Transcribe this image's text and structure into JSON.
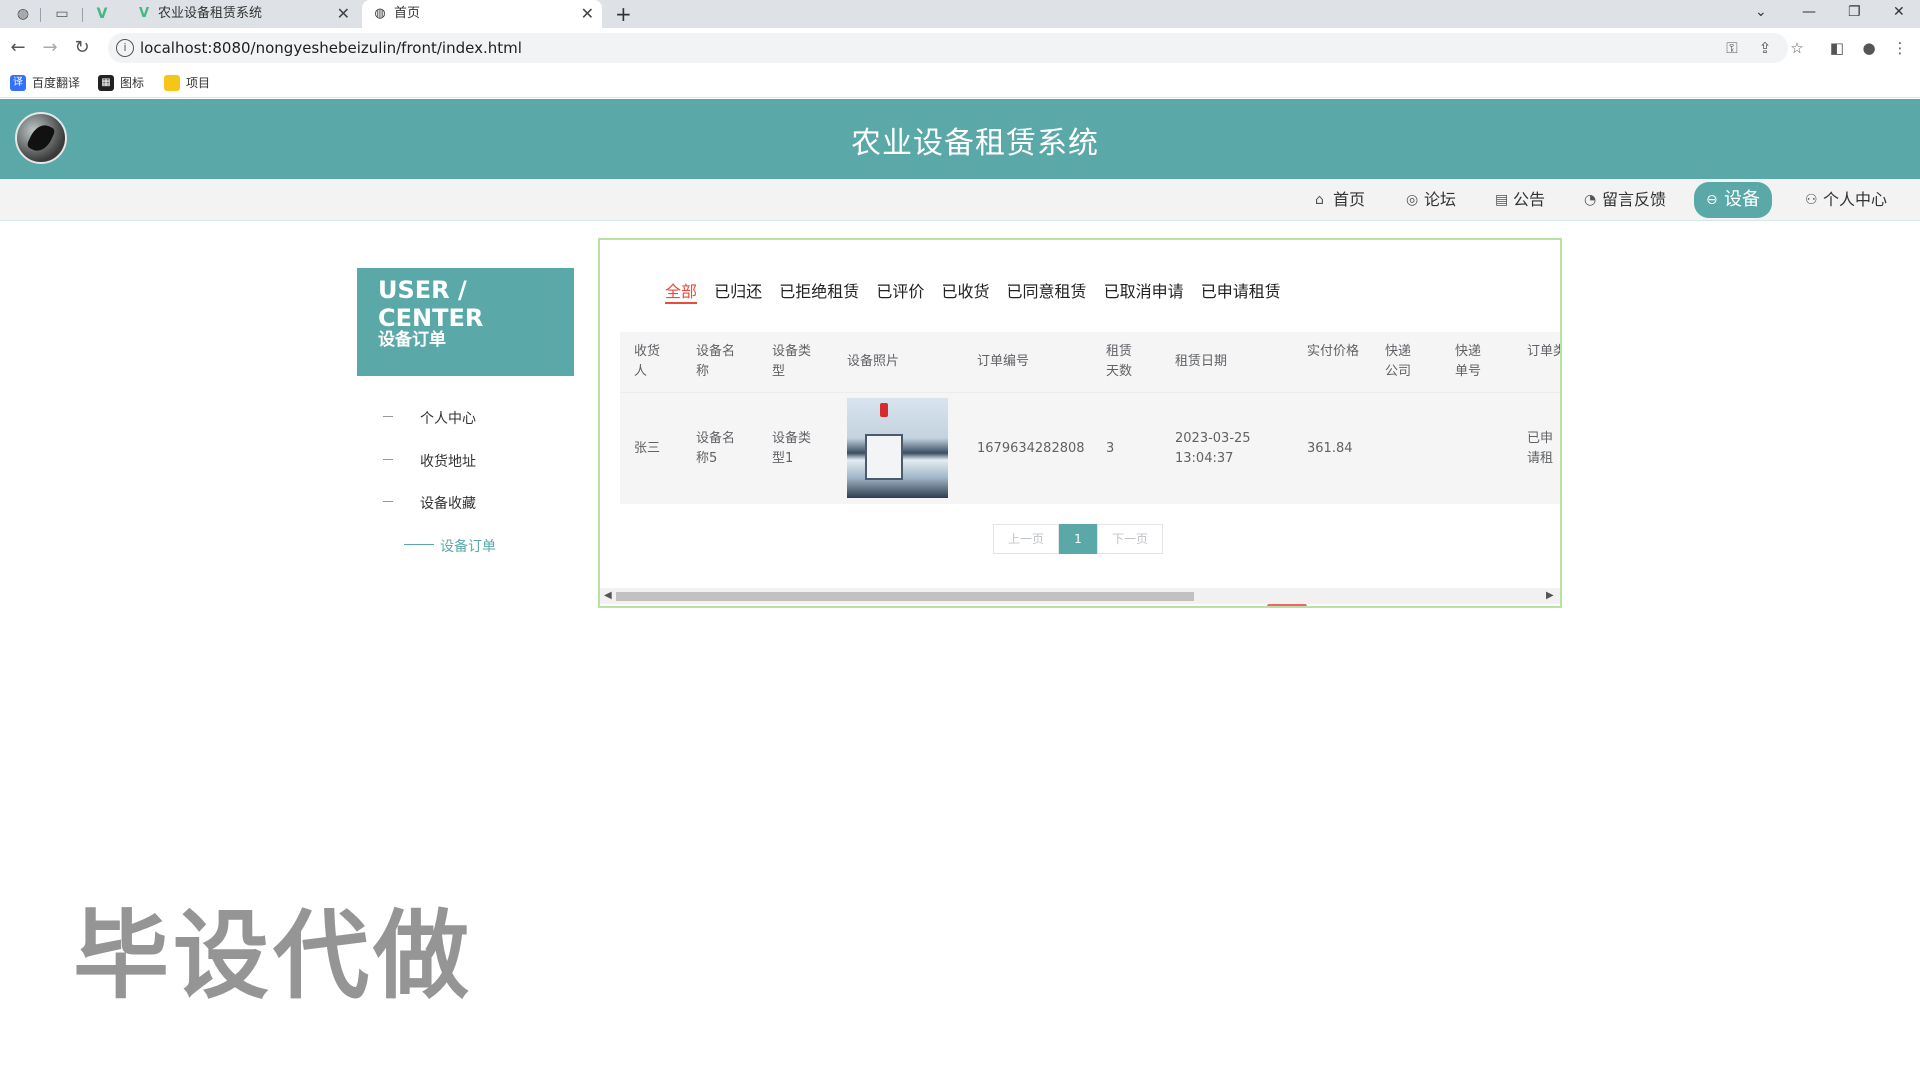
{
  "browser": {
    "tabs": [
      {
        "label": "农业设备租赁系统"
      },
      {
        "label": "首页"
      }
    ],
    "new_tab": "+",
    "url": "localhost:8080/nongyeshebeizulin/front/index.html",
    "bookmarks": [
      {
        "label": "百度翻译"
      },
      {
        "label": "图标"
      },
      {
        "label": "项目"
      }
    ]
  },
  "site": {
    "title": "农业设备租赁系统"
  },
  "nav": {
    "items": [
      {
        "label": "首页",
        "icon": "home-icon"
      },
      {
        "label": "论坛",
        "icon": "globe-icon"
      },
      {
        "label": "公告",
        "icon": "calendar-icon"
      },
      {
        "label": "留言反馈",
        "icon": "feedback-icon"
      },
      {
        "label": "设备",
        "icon": "equipment-icon",
        "active": true
      },
      {
        "label": "个人中心",
        "icon": "user-icon"
      }
    ]
  },
  "sidebar": {
    "heading_en": "USER / CENTER",
    "heading_cn": "设备订单",
    "items": [
      {
        "label": "个人中心"
      },
      {
        "label": "收货地址"
      },
      {
        "label": "设备收藏"
      },
      {
        "label": "设备订单",
        "active": true
      }
    ]
  },
  "filters": {
    "tabs": [
      "全部",
      "已归还",
      "已拒绝租赁",
      "已评价",
      "已收货",
      "已同意租赁",
      "已取消申请",
      "已申请租赁"
    ],
    "active_index": 0
  },
  "table": {
    "headers": [
      "收货人",
      "设备名称",
      "设备类型",
      "设备照片",
      "订单编号",
      "租赁天数",
      "租赁日期",
      "实付价格",
      "快递公司",
      "快递单号",
      "订单类型"
    ],
    "rows": [
      {
        "receiver": "张三",
        "device_name": "设备名称5",
        "device_type": "设备类型1",
        "order_no": "1679634282808",
        "days": "3",
        "date": "2023-03-25 13:04:37",
        "price": "361.84",
        "courier": "",
        "tracking": "",
        "order_type": "已申请租赁"
      }
    ]
  },
  "pager": {
    "prev": "上一页",
    "current": "1",
    "next": "下一页"
  },
  "watermark": "毕设代做",
  "colors": {
    "brand": "#5ba8a8",
    "active_filter": "#e94b3c",
    "panel_border": "#b7e3a0"
  }
}
